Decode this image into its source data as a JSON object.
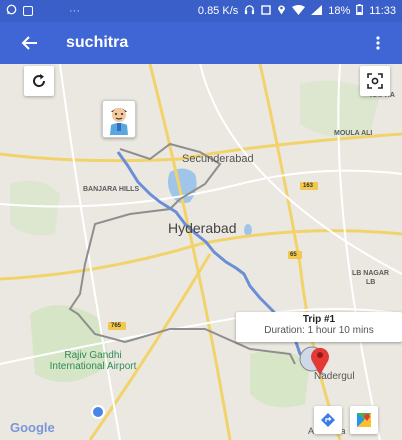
{
  "status_bar": {
    "network_speed": "0.85 K/s",
    "battery": "18%",
    "time": "11:33",
    "dots": "···"
  },
  "app_bar": {
    "title": "suchitra"
  },
  "map": {
    "labels": {
      "secunderabad": "Secunderabad",
      "hyderabad": "Hyderabad",
      "banjara_hills": "BANJARA HILLS",
      "moula_ali": "MOULA ALI",
      "kapra": "KAPRA",
      "lb_nagar": "LB NAGAR",
      "lb": "LB",
      "airport": "Rajiv Gandhi International Airport",
      "nadergul": "Nadergul",
      "adibhatla": "Adibhatla",
      "nh_badge_1": "163",
      "nh_badge_2": "765",
      "nh_badge_3": "65"
    },
    "google_logo": "Google",
    "colors": {
      "route": "#6b8ed6",
      "water": "#9fc6e8",
      "destination_pin": "#e53935"
    }
  },
  "trip_info": {
    "title": "Trip #1",
    "duration": "Duration: 1 hour 10 mins"
  }
}
